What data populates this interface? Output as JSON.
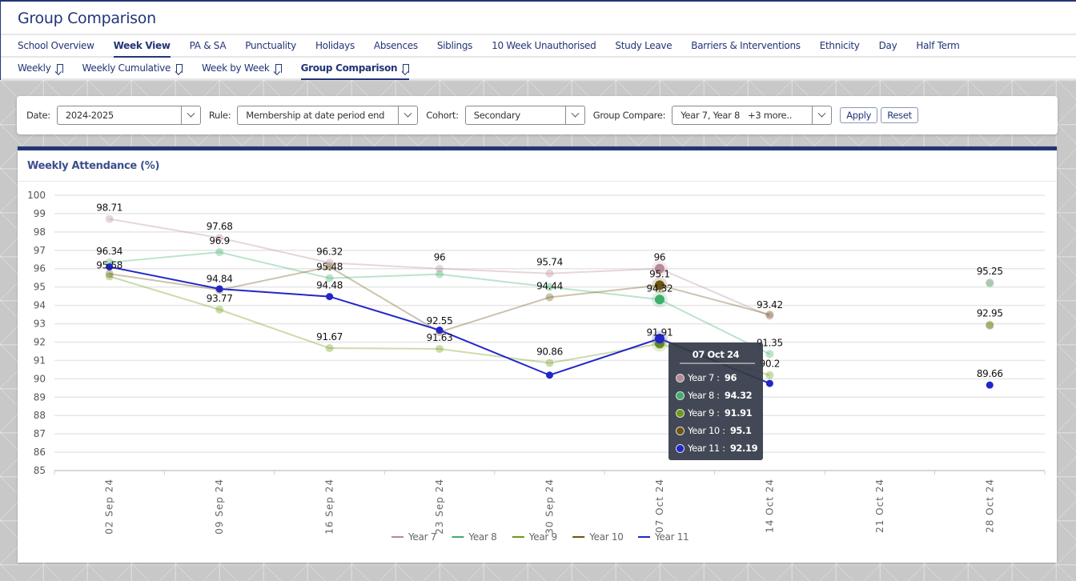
{
  "header": {
    "title": "Group Comparison"
  },
  "main_tabs": [
    {
      "label": "School Overview",
      "active": false
    },
    {
      "label": "Week View",
      "active": true
    },
    {
      "label": "PA & SA",
      "active": false
    },
    {
      "label": "Punctuality",
      "active": false
    },
    {
      "label": "Holidays",
      "active": false
    },
    {
      "label": "Absences",
      "active": false
    },
    {
      "label": "Siblings",
      "active": false
    },
    {
      "label": "10 Week Unauthorised",
      "active": false
    },
    {
      "label": "Study Leave",
      "active": false
    },
    {
      "label": "Barriers & Interventions",
      "active": false
    },
    {
      "label": "Ethnicity",
      "active": false
    },
    {
      "label": "Day",
      "active": false
    },
    {
      "label": "Half Term",
      "active": false
    }
  ],
  "sub_tabs": [
    {
      "label": "Weekly",
      "active": false,
      "icon": "bookmark-icon"
    },
    {
      "label": "Weekly Cumulative",
      "active": false,
      "icon": "bookmark-icon"
    },
    {
      "label": "Week by Week",
      "active": false,
      "icon": "bookmark-icon"
    },
    {
      "label": "Group Comparison",
      "active": true,
      "icon": "bookmark-icon"
    }
  ],
  "filters": {
    "date_label": "Date:",
    "date_value": "2024-2025",
    "rule_label": "Rule:",
    "rule_value": "Membership at date period end",
    "cohort_label": "Cohort:",
    "cohort_value": "Secondary",
    "group_label": "Group Compare:",
    "group_value": "Year 7, Year 8   +3 more..",
    "apply_label": "Apply",
    "reset_label": "Reset"
  },
  "chart_card": {
    "title": "Weekly Attendance (%)"
  },
  "tooltip": {
    "title": "07 Oct 24",
    "rows": [
      {
        "label": "Year 7 : ",
        "value": "96",
        "color": "#b68a96"
      },
      {
        "label": "Year 8 : ",
        "value": "94.32",
        "color": "#3fae6a"
      },
      {
        "label": "Year 9 : ",
        "value": "91.91",
        "color": "#6e9a12"
      },
      {
        "label": "Year 10 : ",
        "value": "95.1",
        "color": "#6b5512"
      },
      {
        "label": "Year 11 : ",
        "value": "92.19",
        "color": "#2326c9"
      }
    ]
  },
  "chart_data": {
    "type": "line",
    "title": "Weekly Attendance (%)",
    "xlabel": "",
    "ylabel": "",
    "categories": [
      "02 Sep 24",
      "09 Sep 24",
      "16 Sep 24",
      "23 Sep 24",
      "30 Sep 24",
      "07 Oct 24",
      "14 Oct 24",
      "21 Oct 24",
      "28 Oct 24"
    ],
    "ylim": [
      85,
      100
    ],
    "yticks": [
      100,
      99,
      98,
      97,
      96,
      95,
      94,
      93,
      92,
      91,
      90,
      89,
      88,
      87,
      86,
      85
    ],
    "grid": true,
    "legend_position": "bottom-center",
    "series": [
      {
        "name": "Year 7",
        "color": "#b68a96",
        "faded": true,
        "values": [
          98.71,
          97.68,
          96.32,
          96,
          95.74,
          96,
          93.42,
          null,
          95.25
        ]
      },
      {
        "name": "Year 8",
        "color": "#3fae6a",
        "faded": true,
        "values": [
          96.34,
          96.9,
          95.48,
          95.7,
          95.0,
          94.32,
          91.35,
          null,
          95.2
        ]
      },
      {
        "name": "Year 9",
        "color": "#6e9a12",
        "faded": true,
        "values": [
          95.58,
          93.77,
          91.67,
          91.63,
          90.86,
          91.91,
          90.2,
          null,
          92.95
        ]
      },
      {
        "name": "Year 10",
        "color": "#6b5512",
        "faded": true,
        "values": [
          95.72,
          94.84,
          96.1,
          92.55,
          94.44,
          95.1,
          93.5,
          null,
          92.9
        ]
      },
      {
        "name": "Year 11",
        "color": "#2326c9",
        "faded": false,
        "values": [
          96.1,
          94.9,
          94.48,
          92.65,
          90.2,
          92.19,
          89.75,
          null,
          89.66
        ]
      }
    ],
    "data_labels": [
      {
        "category": "02 Sep 24",
        "texts": [
          "98.71",
          "96.34",
          "95.58"
        ]
      },
      {
        "category": "09 Sep 24",
        "texts": [
          "97.68",
          "96.9",
          "94.84",
          "93.77"
        ]
      },
      {
        "category": "16 Sep 24",
        "texts": [
          "96.32",
          "95.48",
          "94.48",
          "91.67"
        ]
      },
      {
        "category": "23 Sep 24",
        "texts": [
          "96",
          "92.55",
          "91.63"
        ]
      },
      {
        "category": "30 Sep 24",
        "texts": [
          "95.74",
          "94.44",
          "90.86"
        ]
      },
      {
        "category": "07 Oct 24",
        "texts": [
          "96",
          "95.1",
          "94.32",
          "91.91"
        ]
      },
      {
        "category": "14 Oct 24",
        "texts": [
          "93.42",
          "91.35",
          "90.2"
        ]
      },
      {
        "category": "28 Oct 24",
        "texts": [
          "95.25",
          "92.95",
          "89.66"
        ]
      }
    ],
    "highlighted_category": "07 Oct 24"
  }
}
